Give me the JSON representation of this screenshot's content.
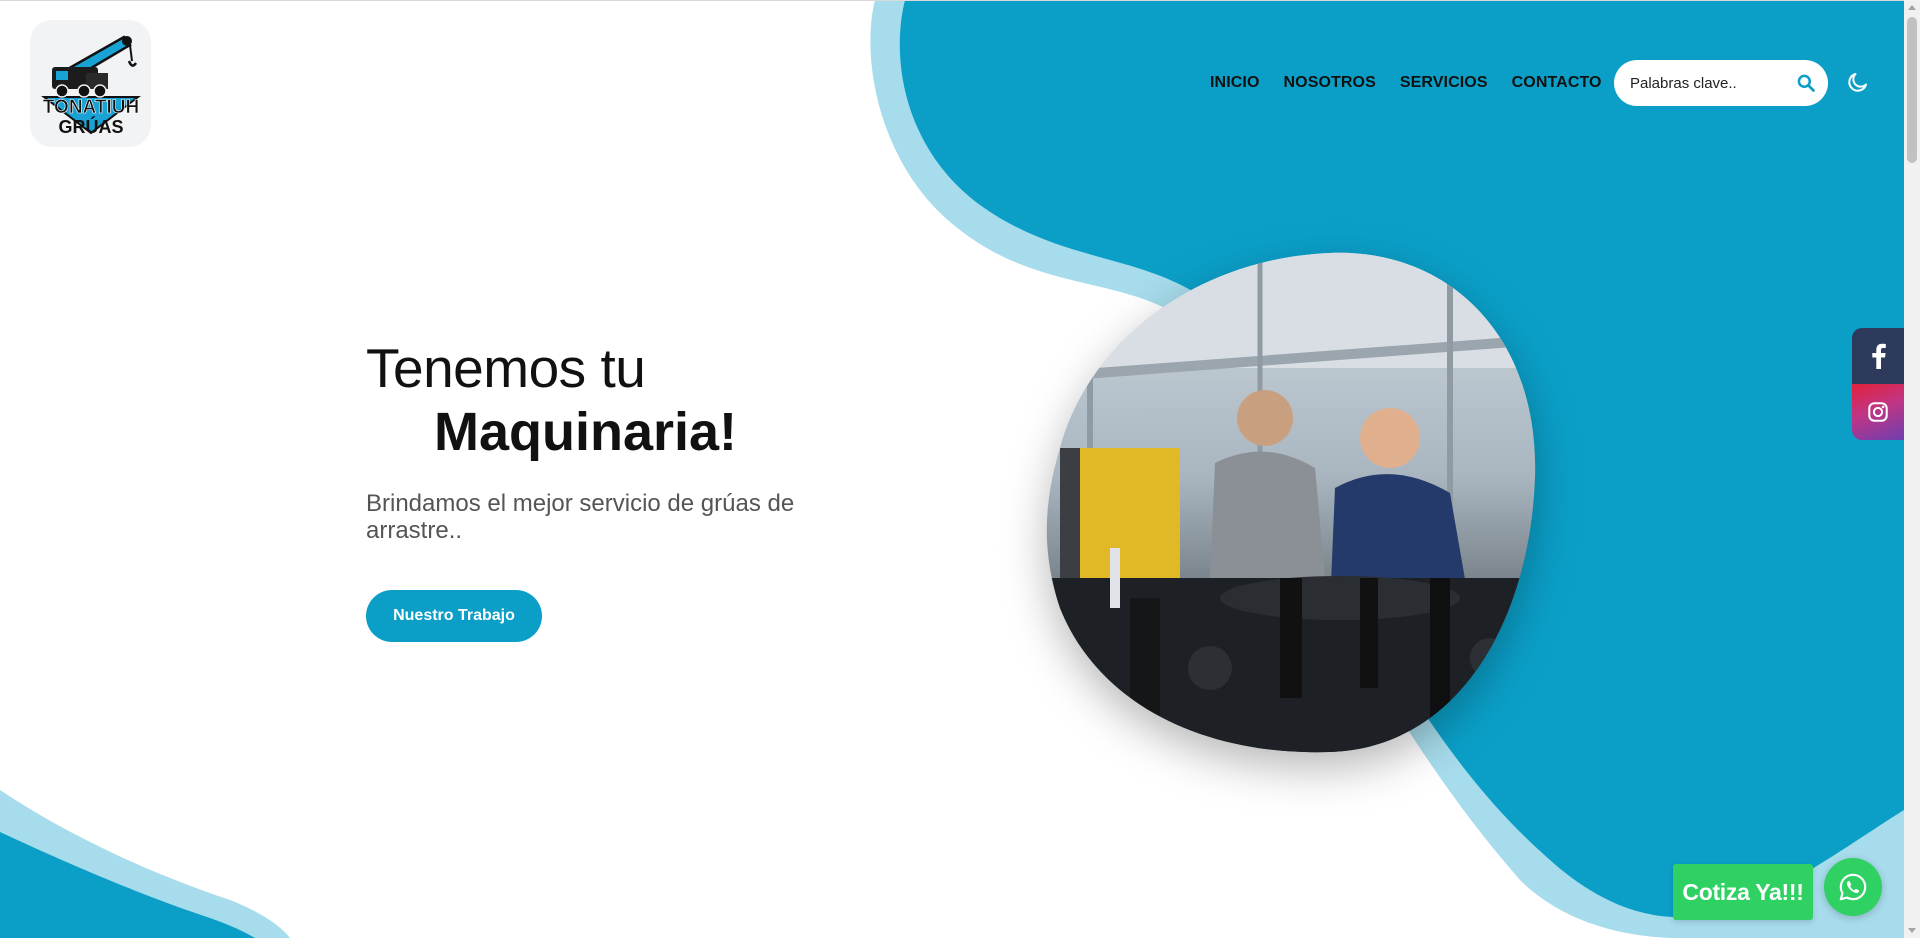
{
  "brand": {
    "logo_line1": "TONATIUH",
    "logo_line2": "GRÚAS"
  },
  "nav": {
    "items": [
      {
        "label": "INICIO"
      },
      {
        "label": "NOSOTROS"
      },
      {
        "label": "SERVICIOS"
      },
      {
        "label": "CONTACTO"
      }
    ]
  },
  "search": {
    "placeholder": "Palabras clave.."
  },
  "hero": {
    "title_line1": "Tenemos tu",
    "title_line2": "Maquinaria!",
    "subtitle": "Brindamos el mejor servicio de grúas de arrastre..",
    "cta_label": "Nuestro Trabajo"
  },
  "floating": {
    "cotiza_label": "Cotiza Ya!!!"
  },
  "icons": {
    "search": "search-icon",
    "theme": "moon-icon",
    "facebook": "facebook-icon",
    "instagram": "instagram-icon",
    "whatsapp": "whatsapp-icon"
  },
  "colors": {
    "primary": "#0b9fc8",
    "primary_light": "#a7dcec",
    "whatsapp_green": "#2fd163",
    "facebook_bg": "#2d3a5c",
    "text_dark": "#111111",
    "text_muted": "#555555"
  }
}
